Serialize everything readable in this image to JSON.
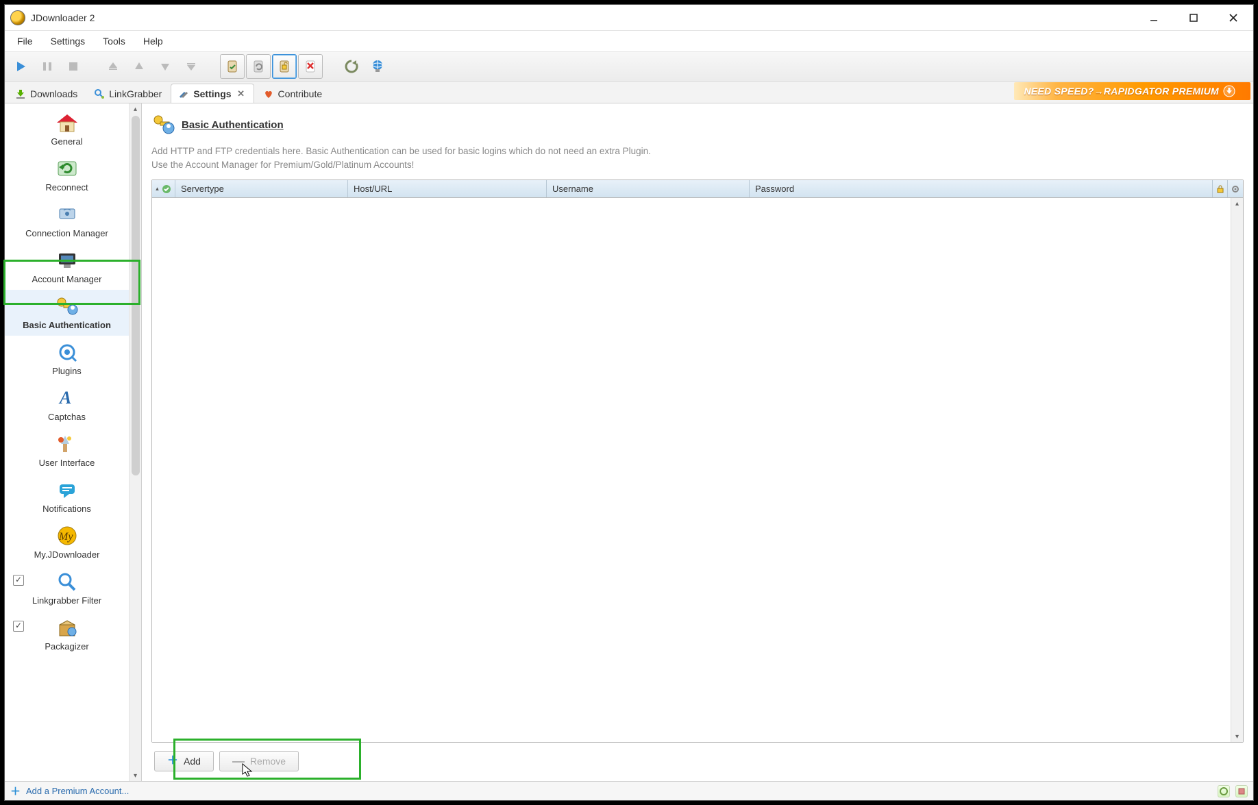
{
  "window": {
    "title": "JDownloader 2"
  },
  "menu": {
    "items": [
      "File",
      "Settings",
      "Tools",
      "Help"
    ]
  },
  "tabs": {
    "items": [
      {
        "label": "Downloads",
        "icon": "download-icon",
        "closable": false
      },
      {
        "label": "LinkGrabber",
        "icon": "linkgrabber-icon",
        "closable": false
      },
      {
        "label": "Settings",
        "icon": "settings-icon",
        "closable": true,
        "active": true
      },
      {
        "label": "Contribute",
        "icon": "heart-icon",
        "closable": false
      }
    ]
  },
  "banner": {
    "text": "NEED SPEED?→RAPIDGATOR PREMIUM"
  },
  "sidebar": {
    "items": [
      {
        "label": "General"
      },
      {
        "label": "Reconnect"
      },
      {
        "label": "Connection Manager"
      },
      {
        "label": "Account Manager"
      },
      {
        "label": "Basic Authentication",
        "selected": true
      },
      {
        "label": "Plugins"
      },
      {
        "label": "Captchas"
      },
      {
        "label": "User Interface"
      },
      {
        "label": "Notifications"
      },
      {
        "label": "My.JDownloader"
      },
      {
        "label": "Linkgrabber Filter",
        "checkbox": true
      },
      {
        "label": "Packagizer",
        "checkbox": true
      }
    ]
  },
  "page": {
    "title": "Basic Authentication",
    "desc1": "Add HTTP and FTP credentials here. Basic Authentication can be used for basic logins which do not need an extra Plugin.",
    "desc2": "Use the Account Manager for Premium/Gold/Platinum Accounts!"
  },
  "table": {
    "columns": [
      "Servertype",
      "Host/URL",
      "Username",
      "Password"
    ],
    "rows": []
  },
  "buttons": {
    "add": "Add",
    "remove": "Remove"
  },
  "statusbar": {
    "add_premium": "Add a Premium Account..."
  }
}
